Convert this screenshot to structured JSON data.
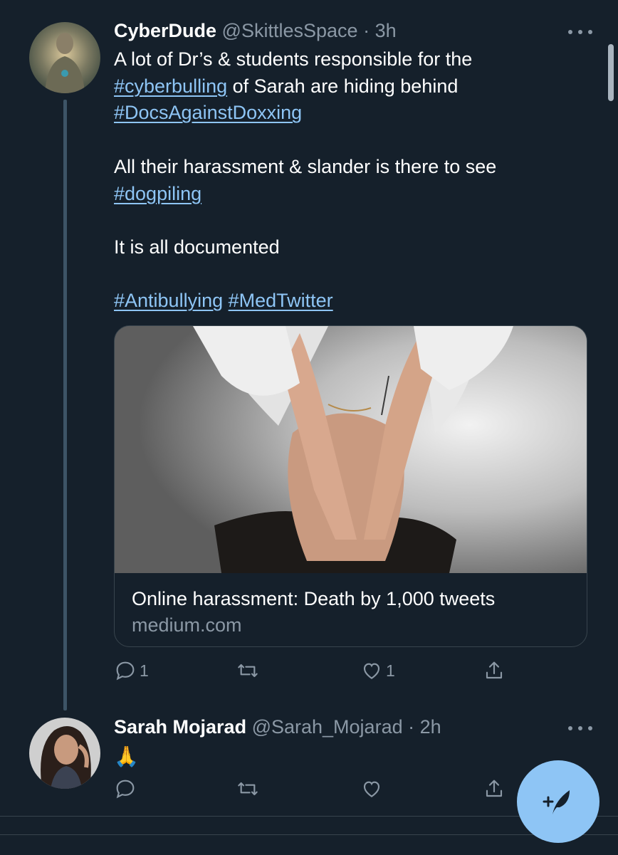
{
  "tweets": [
    {
      "author_name": "CyberDude",
      "handle": "@SkittlesSpace",
      "separator": "·",
      "time": "3h",
      "lines": {
        "l1": "A lot of Dr’s & students responsible for the",
        "l2_tag": "#cyberbulling",
        "l2_rest": " of Sarah are hiding behind",
        "l3_tag": "#DocsAgainstDoxxing",
        "l4": "All their harassment & slander is there to see",
        "l5_tag": "#dogpiling",
        "l6": "It is all documented",
        "l7_tag1": "#Antibullying",
        "l7_tag2": "#MedTwitter"
      },
      "card": {
        "title": "Online harassment: Death by 1,000 tweets",
        "domain": "medium.com"
      },
      "reply_count": "1",
      "like_count": "1"
    },
    {
      "author_name": "Sarah Mojarad",
      "handle": "@Sarah_Mojarad",
      "separator": "·",
      "time": "2h",
      "text": "🙏",
      "reply_count": "",
      "like_count": ""
    }
  ],
  "icons": {
    "more": "more-horizontal-icon",
    "reply": "reply-icon",
    "retweet": "retweet-icon",
    "like": "heart-icon",
    "share": "share-icon",
    "compose": "compose-tweet-icon"
  },
  "colors": {
    "background": "#15202b",
    "link": "#8ec5f5",
    "secondary_text": "#8b98a5",
    "fab": "#8ec5f5"
  }
}
